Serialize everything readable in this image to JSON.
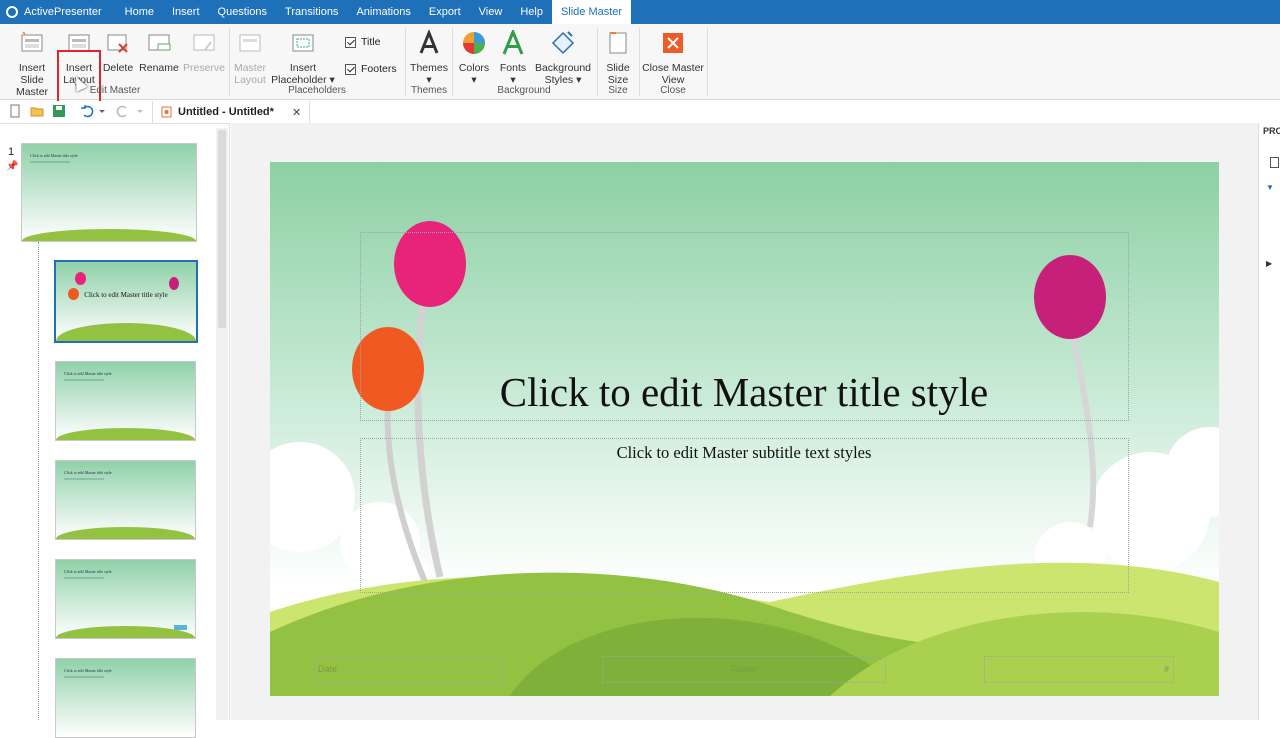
{
  "app": {
    "title": "ActivePresenter"
  },
  "menu": {
    "items": [
      "Home",
      "Insert",
      "Questions",
      "Transitions",
      "Animations",
      "Export",
      "View",
      "Help",
      "Slide Master"
    ],
    "active": "Slide Master"
  },
  "ribbon": {
    "edit_master": {
      "insert_slide_master": [
        "Insert Slide",
        "Master"
      ],
      "insert_layout": [
        "Insert",
        "Layout"
      ],
      "delete": "Delete",
      "rename": "Rename",
      "preserve": "Preserve",
      "group_label": "Edit Master"
    },
    "placeholders": {
      "master_layout": [
        "Master",
        "Layout"
      ],
      "insert_placeholder": [
        "Insert",
        "Placeholder"
      ],
      "title_checkbox": "Title",
      "footers_checkbox": "Footers",
      "group_label": "Placeholders"
    },
    "themes": {
      "themes": "Themes",
      "group_label": "Themes"
    },
    "background": {
      "colors": "Colors",
      "fonts": "Fonts",
      "background_styles": [
        "Background",
        "Styles"
      ],
      "group_label": "Background"
    },
    "size": {
      "slide_size": [
        "Slide",
        "Size"
      ],
      "group_label": "Size"
    },
    "close": {
      "close_master_view": [
        "Close Master",
        "View"
      ],
      "group_label": "Close"
    }
  },
  "document_tab": {
    "title": "Untitled - Untitled*"
  },
  "left_panel": {
    "slide_number": "1",
    "thumb_title": "Click to edit Master title style"
  },
  "slide": {
    "title": "Click to edit Master title style",
    "subtitle": "Click to edit Master subtitle text styles",
    "footer_date": "Date",
    "footer_center": "Footer",
    "footer_number": "#"
  },
  "right_panel": {
    "label": "PRO"
  },
  "colors": {
    "accent": "#1e70b8",
    "highlight": "#e0242c",
    "balloon_pink": "#e8247a",
    "balloon_orange": "#f05a22",
    "hill_green": "#93c142"
  }
}
